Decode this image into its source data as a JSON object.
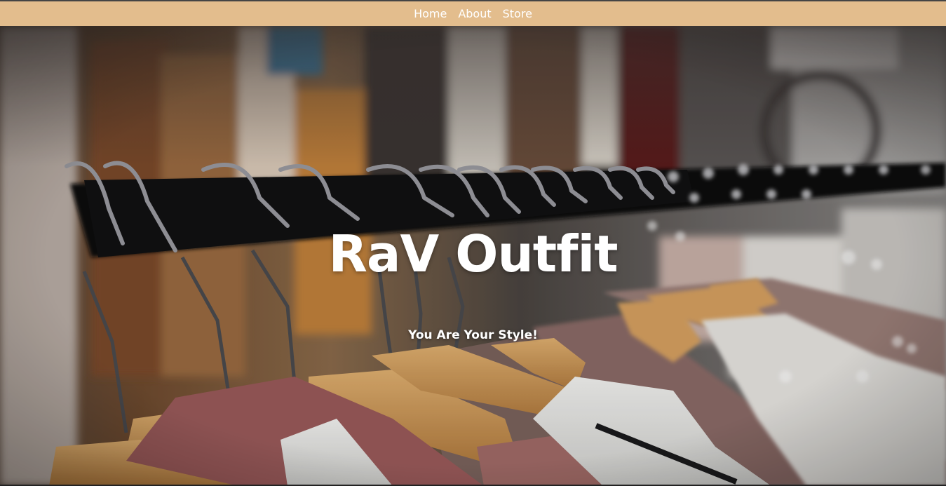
{
  "nav": {
    "items": [
      {
        "label": "Home"
      },
      {
        "label": "About"
      },
      {
        "label": "Store"
      }
    ]
  },
  "hero": {
    "title": "RaV Outfit",
    "subtitle": "You Are Your Style!",
    "background": "hangers-on-clothing-rack-photo"
  },
  "colors": {
    "navbar": "#e3bd8d",
    "nav_text": "#ffffff",
    "hero_text": "#ffffff"
  }
}
